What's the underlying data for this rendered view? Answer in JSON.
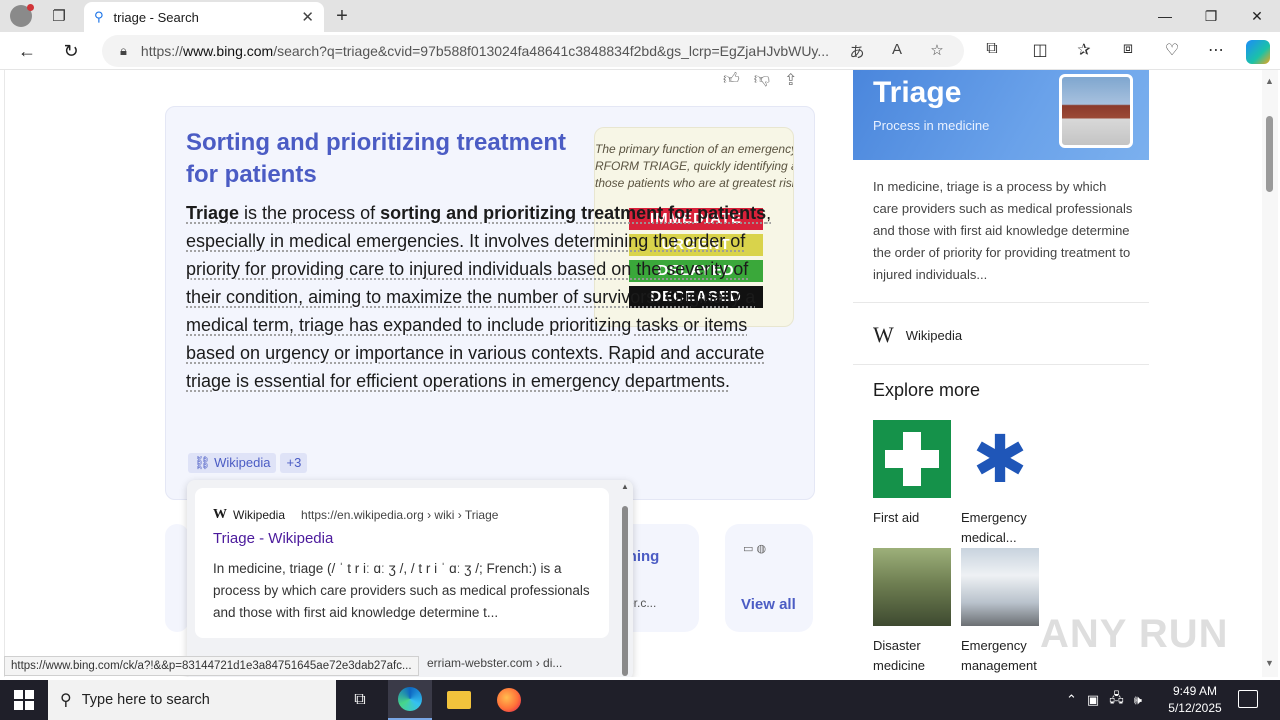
{
  "browser": {
    "tab_title": "triage - Search",
    "url_prefix": "https://",
    "url_host": "www.bing.com",
    "url_rest": "/search?q=triage&cvid=97b588f013024fa48641c3848834f2bd&gs_lcrp=EgZjaHJvbWUy...",
    "status_url": "https://www.bing.com/ck/a?!&&p=83144721d1e3a84751645ae72e3dab27afc..."
  },
  "answer": {
    "heading": "Sorting and prioritizing treatment for patients",
    "p1_a": "Triage",
    "p1_b": " is the process of ",
    "p1_c": "sorting and prioritizing treatment for patients",
    "p1_d": ", especially in medical emergencies. It involves determining the order of priority for providing care to injured individuals based on the severity of their condition, aiming to maximize the number of survivors. Originally a medical term, triage has expanded to include prioritizing tasks or items based on urgency or importance in various contexts. Rapid and accurate triage is essential for efficient operations in emergency departments.",
    "image_caption_1": "The primary function of an emergency roo",
    "image_caption_2": "RFORM TRIAGE, quickly identifying an",
    "image_caption_3": "those patients who are at greatest risk",
    "tags": [
      "IMMEDIATE",
      "URGENT",
      "DELAYED",
      "DECEASED"
    ],
    "tag_colors": [
      "#d8213a",
      "#d9d34b",
      "#3aa83a",
      "#111111"
    ],
    "source_label": "Wikipedia",
    "more_sources": "+3"
  },
  "cards": {
    "meaning_text": "eaning",
    "meaning_sub": "bster.c...",
    "view_all": "View all"
  },
  "popup": {
    "source": "Wikipedia",
    "url": "https://en.wikipedia.org › wiki › Triage",
    "title": "Triage - Wikipedia",
    "desc": "In medicine, triage (/ ˈ t r iː ɑː ʒ /, / t r i ˈ ɑː ʒ /; French:) is a process by which care providers such as medical professionals and those with first aid knowledge determine t...",
    "next_partial": "erriam-webster.com › di..."
  },
  "side": {
    "title": "Triage",
    "subtitle": "Process in medicine",
    "desc": "In medicine, triage is a process by which care providers such as medical professionals and those with first aid knowledge determine the order of priority for providing treatment to injured individuals...",
    "wiki_label": "Wikipedia",
    "explore_title": "Explore more",
    "explore": [
      {
        "label": "First aid"
      },
      {
        "label": "Emergency medical..."
      },
      {
        "label": "Disaster medicine"
      },
      {
        "label": "Emergency management"
      }
    ]
  },
  "taskbar": {
    "search_placeholder": "Type here to search",
    "time": "9:49 AM",
    "date": "5/12/2025"
  },
  "watermark": "ANY RUN"
}
